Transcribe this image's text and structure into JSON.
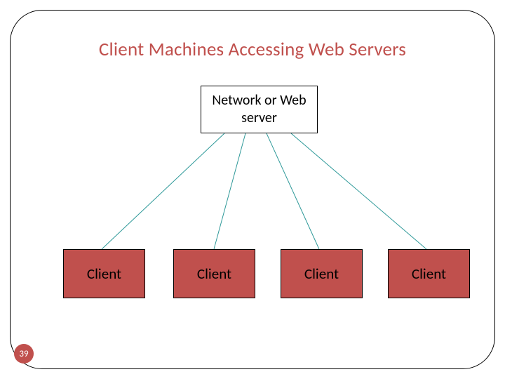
{
  "title": "Client Machines Accessing Web Servers",
  "server": {
    "label": "Network or Web\nserver"
  },
  "clients": [
    {
      "label": "Client"
    },
    {
      "label": "Client"
    },
    {
      "label": "Client"
    },
    {
      "label": "Client"
    }
  ],
  "page_number": "39",
  "colors": {
    "accent": "#c0504d",
    "line": "#2e9999"
  }
}
